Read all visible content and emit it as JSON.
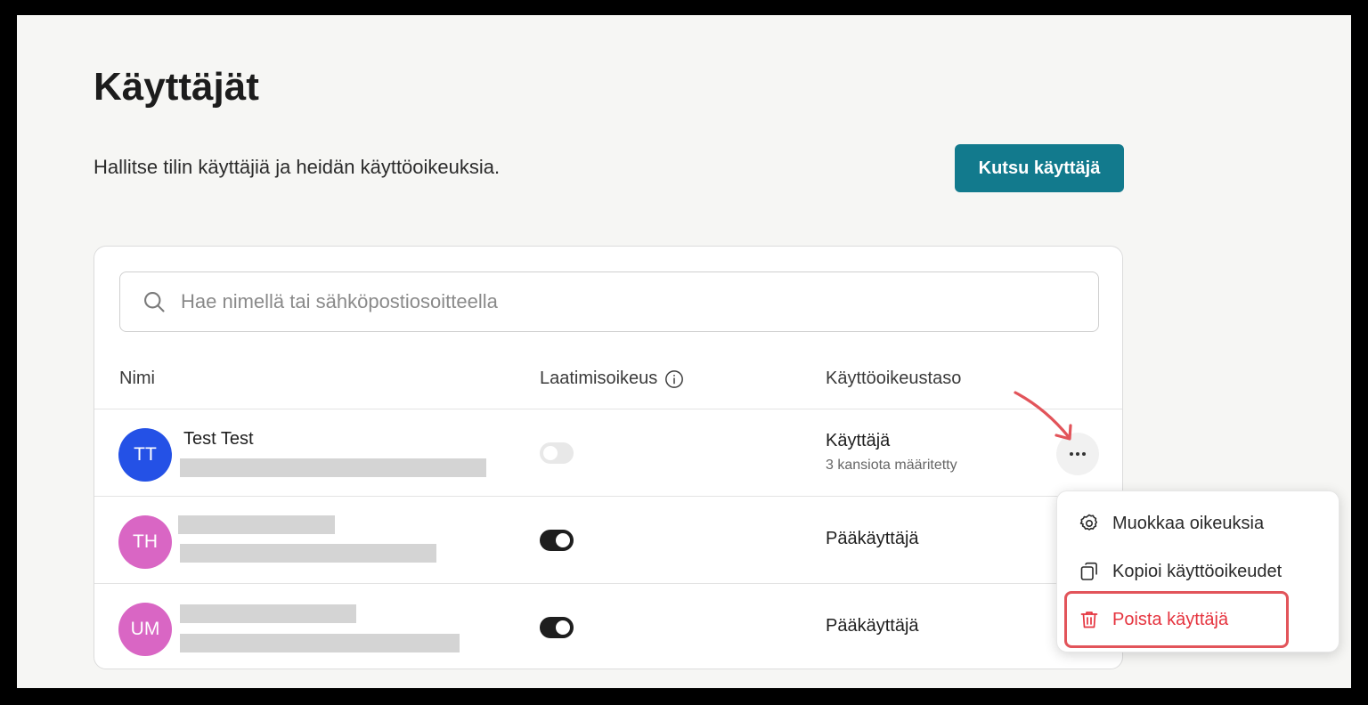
{
  "page": {
    "title": "Käyttäjät",
    "subtitle": "Hallitse tilin käyttäjiä ja heidän käyttöoikeuksia.",
    "invite_button": "Kutsu käyttäjä"
  },
  "search": {
    "placeholder": "Hae nimellä tai sähköpostiosoitteella",
    "value": ""
  },
  "table": {
    "headers": {
      "name": "Nimi",
      "compose_right": "Laatimisoikeus",
      "access_level": "Käyttöoikeustaso"
    },
    "rows": [
      {
        "initials": "TT",
        "name": "Test Test",
        "avatar_color": "#2451e6",
        "compose_enabled": false,
        "role": "Käyttäjä",
        "role_sub": "3 kansiota määritetty"
      },
      {
        "initials": "TH",
        "name": "",
        "avatar_color": "#d966c4",
        "compose_enabled": true,
        "role": "Pääkäyttäjä",
        "role_sub": ""
      },
      {
        "initials": "UM",
        "name": "",
        "avatar_color": "#d966c4",
        "compose_enabled": true,
        "role": "Pääkäyttäjä",
        "role_sub": ""
      }
    ]
  },
  "context_menu": {
    "items": [
      {
        "label": "Muokkaa oikeuksia",
        "icon": "gear-icon"
      },
      {
        "label": "Kopioi käyttöoikeudet",
        "icon": "copy-icon"
      },
      {
        "label": "Poista käyttäjä",
        "icon": "trash-icon"
      }
    ]
  },
  "colors": {
    "accent": "#127a8d",
    "danger": "#e5343f",
    "annotation": "#e2545a"
  }
}
